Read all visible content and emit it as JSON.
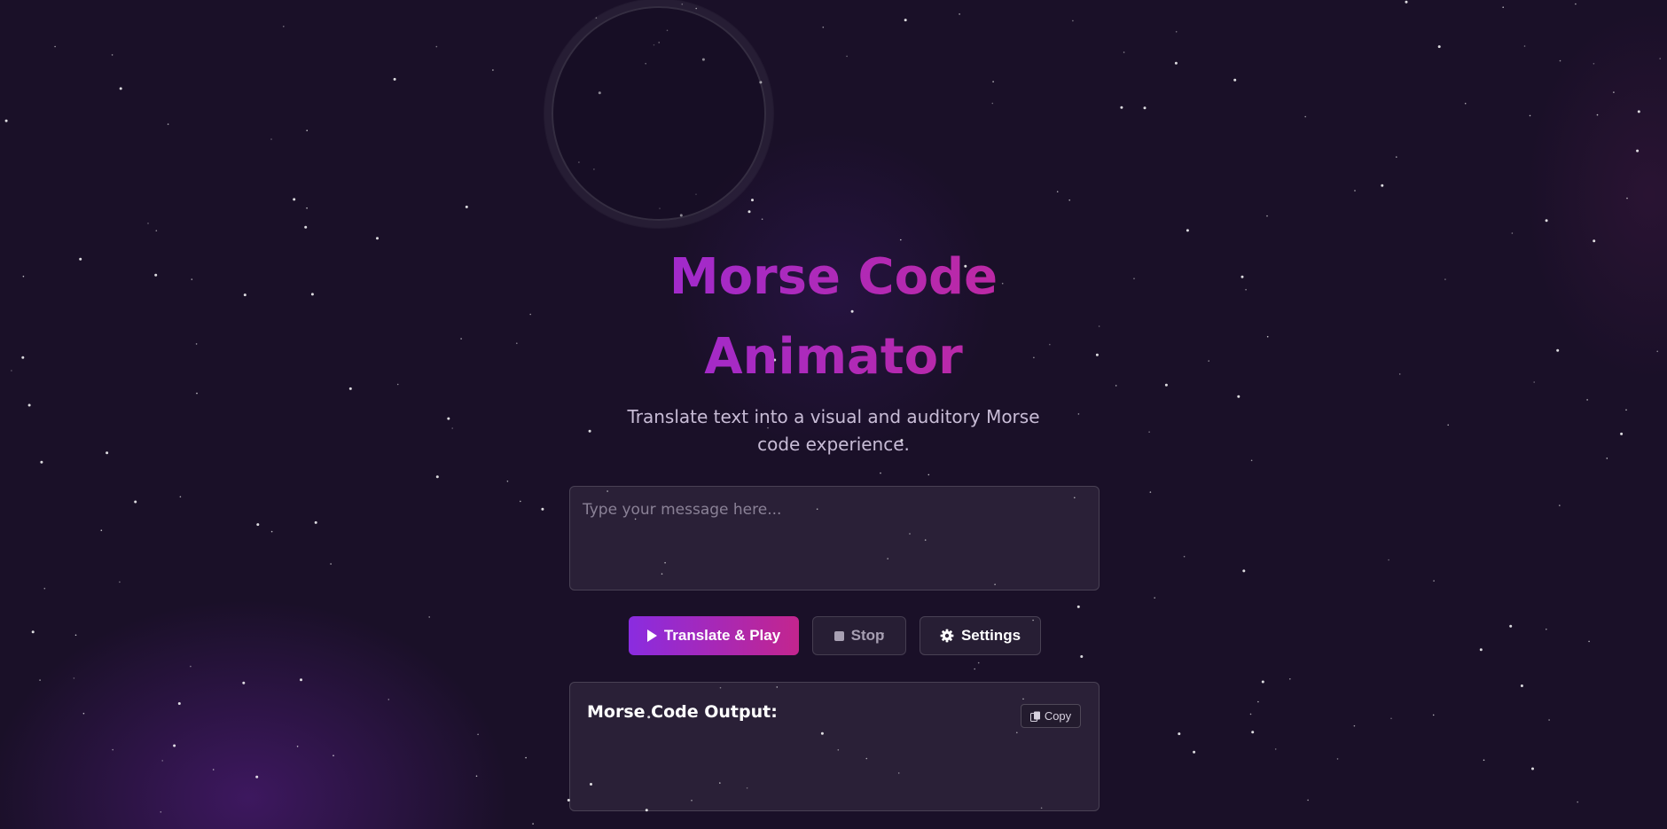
{
  "header": {
    "title": "Morse Code Animator",
    "subtitle": "Translate text into a visual and auditory Morse code experience."
  },
  "message_input": {
    "value": "",
    "placeholder": "Type your message here..."
  },
  "controls": {
    "translate_play_label": "Translate & Play",
    "stop_label": "Stop",
    "settings_label": "Settings"
  },
  "output": {
    "heading": "Morse Code Output:",
    "copy_label": "Copy",
    "morse_text": ""
  },
  "icons": {
    "play": "play-icon",
    "stop": "stop-icon",
    "settings": "gear-icon",
    "copy": "copy-icon"
  },
  "colors": {
    "background": "#1a1028",
    "title_gradient_start": "#9a2bd6",
    "title_gradient_end": "#c3289a",
    "primary_button_start": "#8a2ce0",
    "primary_button_end": "#c3258e",
    "subtitle_text": "#c8bcd6"
  }
}
